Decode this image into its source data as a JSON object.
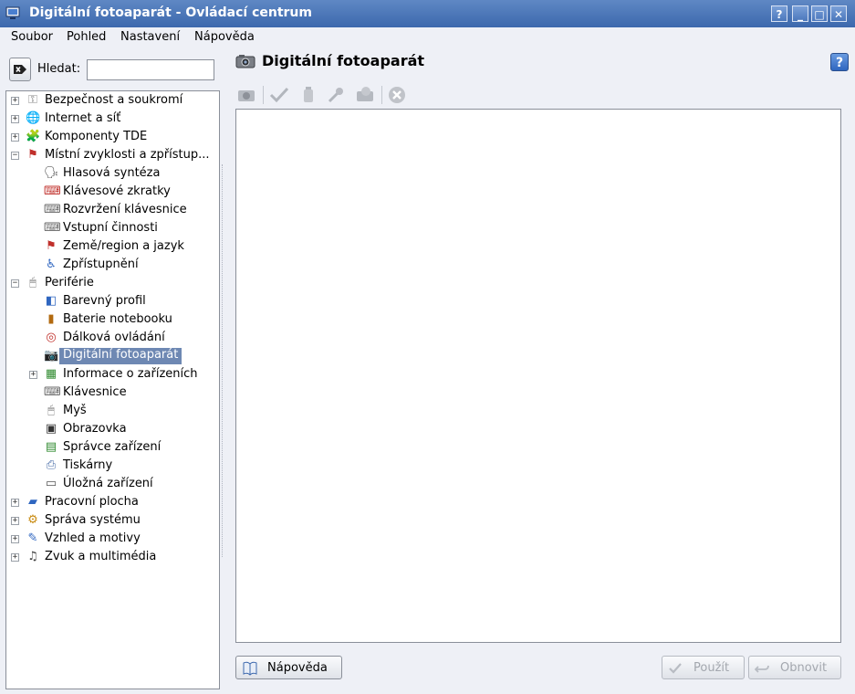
{
  "window": {
    "title": "Digitální fotoaparát - Ovládací centrum",
    "buttons": {
      "help": "?",
      "minimize": "_",
      "maximize": "□",
      "close": "✕"
    }
  },
  "menu": [
    "Soubor",
    "Pohled",
    "Nastavení",
    "Nápověda"
  ],
  "search": {
    "label": "Hledat:",
    "value": ""
  },
  "tree": [
    {
      "label": "Bezpečnost a soukromí",
      "level": 0,
      "expander": "+",
      "icon": "keys-icon"
    },
    {
      "label": "Internet a síť",
      "level": 0,
      "expander": "+",
      "icon": "globe-icon"
    },
    {
      "label": "Komponenty TDE",
      "level": 0,
      "expander": "+",
      "icon": "components-icon"
    },
    {
      "label": "Místní zvyklosti a zpřístup...",
      "level": 0,
      "expander": "−",
      "icon": "flag-icon"
    },
    {
      "label": "Hlasová syntéza",
      "level": 1,
      "icon": "speech-icon"
    },
    {
      "label": "Klávesové zkratky",
      "level": 1,
      "icon": "shortcut-icon"
    },
    {
      "label": "Rozvržení klávesnice",
      "level": 1,
      "icon": "keyboard-icon"
    },
    {
      "label": "Vstupní činnosti",
      "level": 1,
      "icon": "keyboard-icon"
    },
    {
      "label": "Země/region a jazyk",
      "level": 1,
      "icon": "flag-icon"
    },
    {
      "label": "Zpřístupnění",
      "level": 1,
      "icon": "accessibility-icon"
    },
    {
      "label": "Periférie",
      "level": 0,
      "expander": "−",
      "icon": "mouse-icon"
    },
    {
      "label": "Barevný profil",
      "level": 1,
      "icon": "color-profile-icon"
    },
    {
      "label": "Baterie notebooku",
      "level": 1,
      "icon": "battery-icon"
    },
    {
      "label": "Dálková ovládání",
      "level": 1,
      "icon": "remote-icon"
    },
    {
      "label": "Digitální fotoaparát",
      "level": 1,
      "icon": "camera-icon",
      "selected": true
    },
    {
      "label": "Informace o zařízeních",
      "level": 1,
      "expander": "+",
      "icon": "devices-info-icon"
    },
    {
      "label": "Klávesnice",
      "level": 1,
      "icon": "keyboard-icon"
    },
    {
      "label": "Myš",
      "level": 1,
      "icon": "mouse-icon"
    },
    {
      "label": "Obrazovka",
      "level": 1,
      "icon": "display-icon"
    },
    {
      "label": "Správce zařízení",
      "level": 1,
      "icon": "device-manager-icon"
    },
    {
      "label": "Tiskárny",
      "level": 1,
      "icon": "printer-icon"
    },
    {
      "label": "Úložná zařízení",
      "level": 1,
      "icon": "storage-icon"
    },
    {
      "label": "Pracovní plocha",
      "level": 0,
      "expander": "+",
      "icon": "desktop-icon"
    },
    {
      "label": "Správa systému",
      "level": 0,
      "expander": "+",
      "icon": "system-admin-icon"
    },
    {
      "label": "Vzhled a motivy",
      "level": 0,
      "expander": "+",
      "icon": "appearance-icon"
    },
    {
      "label": "Zvuk a multimédia",
      "level": 0,
      "expander": "+",
      "icon": "sound-icon"
    }
  ],
  "module": {
    "title": "Digitální fotoaparát",
    "help_icon": "?"
  },
  "toolbar": [
    "camera-icon",
    "check-icon",
    "trash-icon",
    "wrench-icon",
    "info-icon",
    "stop-icon"
  ],
  "footer": {
    "help": "Nápověda",
    "apply": "Použít",
    "reset": "Obnovit"
  },
  "colors": {
    "titlebar": "#3c68ad",
    "selection": "#6e88b3"
  }
}
